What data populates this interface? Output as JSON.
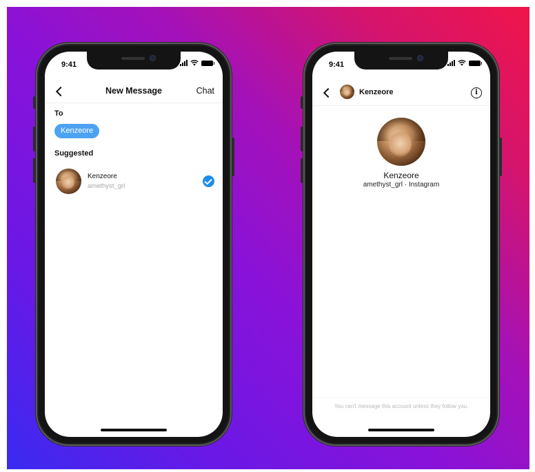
{
  "status_bar": {
    "time": "9:41"
  },
  "new_message_screen": {
    "title": "New Message",
    "back_icon": "chevron-left-icon",
    "chat_label": "Chat",
    "to_label": "To",
    "recipient_chip": "Kenzeore",
    "suggested_label": "Suggested",
    "suggested": [
      {
        "name": "Kenzeore",
        "username": "amethyst_grl",
        "selected": true
      }
    ]
  },
  "conversation_screen": {
    "header_name": "Kenzeore",
    "info_icon": "info-icon",
    "profile_name": "Kenzeore",
    "profile_subtitle": "amethyst_grl · Instagram",
    "footer_note": "You can't message this account unless they follow you."
  },
  "colors": {
    "chip_blue": "#4da3f1",
    "check_blue": "#1f8ee8",
    "gradient": [
      "#3a2bf0",
      "#8a12d8",
      "#f0154a"
    ]
  }
}
